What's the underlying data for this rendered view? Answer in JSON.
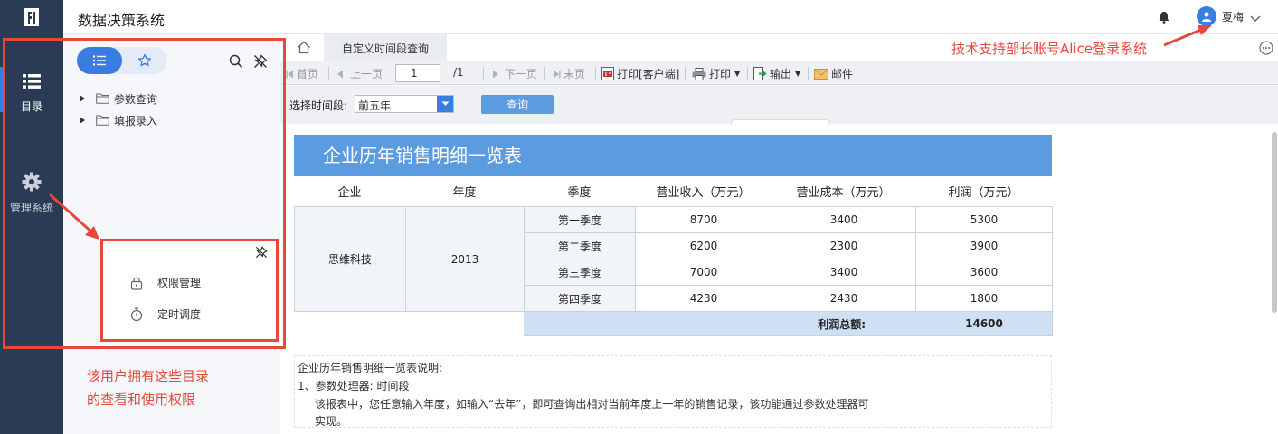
{
  "header": {
    "app_title": "数据决策系统",
    "user_name": "夏梅",
    "icons": {
      "logo": "fr-logo",
      "bell": "bell-icon",
      "avatar": "user-avatar-icon",
      "caret": "chevron-down-icon"
    }
  },
  "leftnav": {
    "items": [
      {
        "label": "目录",
        "icon": "list-icon",
        "active": true
      },
      {
        "label": "管理系统",
        "icon": "gear-icon",
        "active": false
      }
    ]
  },
  "tree_panel": {
    "segments": [
      "list-icon",
      "star-icon"
    ],
    "items": [
      {
        "label": "参数查询",
        "icon": "folder-icon"
      },
      {
        "label": "填报录入",
        "icon": "folder-icon"
      }
    ]
  },
  "sub_panel": {
    "items": [
      {
        "label": "权限管理",
        "icon": "lock-icon"
      },
      {
        "label": "定时调度",
        "icon": "stopwatch-icon"
      }
    ]
  },
  "annotations": {
    "left_note_line1": "该用户拥有这些目录",
    "left_note_line2": "的查看和使用权限",
    "top_note": "技术支持部长账号Alice登录系统",
    "accent": "#e8483b"
  },
  "tabs": {
    "active_label": "自定义时间段查询"
  },
  "toolbar": {
    "first": "首页",
    "prev": "上一页",
    "page_value": "1",
    "page_total": "/1",
    "next": "下一页",
    "last": "末页",
    "print_client": "打印[客户端]",
    "print": "打印",
    "export": "输出",
    "mail": "邮件"
  },
  "params": {
    "label": "选择时间段:",
    "select_value": "前五年",
    "query_button": "查询"
  },
  "report": {
    "title": "企业历年销售明细一览表",
    "columns": [
      "企业",
      "年度",
      "季度",
      "营业收入（万元）",
      "营业成本（万元）",
      "利润（万元）"
    ],
    "company": "思维科技",
    "year": "2013",
    "rows": [
      {
        "quarter": "第一季度",
        "revenue": "8700",
        "cost": "3400",
        "profit": "5300"
      },
      {
        "quarter": "第二季度",
        "revenue": "6200",
        "cost": "2300",
        "profit": "3900"
      },
      {
        "quarter": "第三季度",
        "revenue": "7000",
        "cost": "3400",
        "profit": "3600"
      },
      {
        "quarter": "第四季度",
        "revenue": "4230",
        "cost": "2430",
        "profit": "1800"
      }
    ],
    "total_label": "利润总额:",
    "total_value": "14600",
    "notes": {
      "line1": "企业历年销售明细一览表说明:",
      "line2": "1、参数处理器: 时间段",
      "line3": "该报表中，您任意输入年度，如输入“去年”，即可查询出相对当前年度上一年的销售记录，该功能通过参数处理器可",
      "line4": "实现。"
    },
    "colors": {
      "title_bg": "#5b9be0",
      "total_bg": "#d0e0f4"
    }
  }
}
